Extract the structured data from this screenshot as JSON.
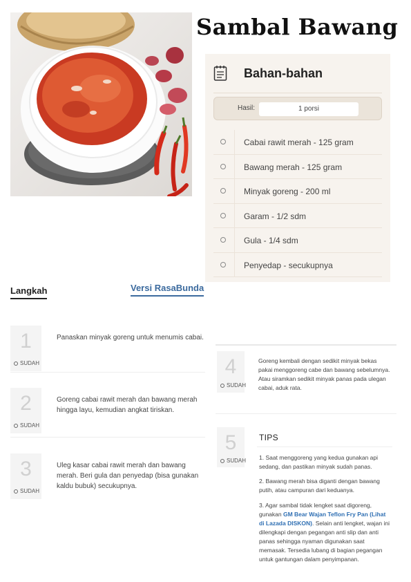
{
  "title": "Sambal Bawang",
  "ingredients": {
    "heading": "Bahan-bahan",
    "yield_label": "Hasil:",
    "yield_value": "1 porsi",
    "items": [
      "Cabai rawit merah - 125 gram",
      "Bawang merah - 125 gram",
      "Minyak goreng - 200 ml",
      "Garam - 1/2 sdm",
      "Gula - 1/4 sdm",
      "Penyedap - secukupnya"
    ]
  },
  "steps_header": {
    "tab_label": "Langkah",
    "version_label": "Versi RasaBunda"
  },
  "done_label": "SUDAH",
  "steps": [
    {
      "number": "1",
      "text": "Panaskan minyak goreng untuk menumis cabai."
    },
    {
      "number": "2",
      "text": "Goreng cabai rawit merah dan bawang merah hingga layu, kemudian angkat tiriskan."
    },
    {
      "number": "3",
      "text": "Uleg kasar cabai rawit merah dan bawang merah. Beri gula dan penyedap (bisa gunakan kaldu bubuk) secukupnya."
    },
    {
      "number": "4",
      "text": "Goreng kembali dengan sedikit minyak bekas pakai menggoreng cabe dan bawang sebelumnya. Atau siramkan sedikit minyak panas pada ulegan cabai, aduk rata."
    },
    {
      "number": "5",
      "text": ""
    }
  ],
  "tips": {
    "title": "TIPS",
    "tip1": "1. Saat menggoreng yang kedua gunakan api sedang, dan pastikan minyak sudah panas.",
    "tip2": "2. Bawang merah bisa diganti dengan bawang putih, atau campuran dari keduanya.",
    "tip3_before": "3. Agar sambal tidak lengket saat digoreng, gunakan ",
    "tip3_link": "GM Bear Wajan Teflon Fry Pan (Lihat di Lazada DISKON)",
    "tip3_after": ". Selain anti lengket, wajan ini dilengkapi dengan pegangan anti slip dan anti panas sehingga nyaman digunakan saat memasak. Tersedia lubang di bagian pegangan untuk gantungan dalam penyimpanan."
  },
  "colors": {
    "accent_link": "#3b6a9e",
    "card_bg": "#f7f3ee",
    "sambal": "#d2452a"
  }
}
